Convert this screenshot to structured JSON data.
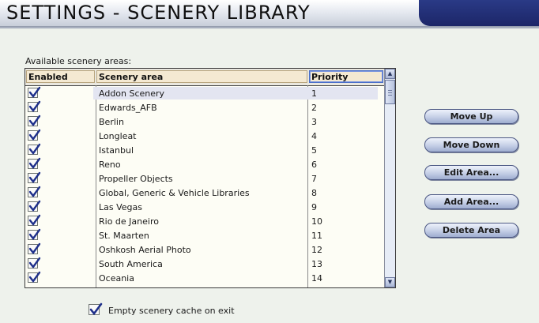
{
  "header": {
    "title": "SETTINGS - SCENERY LIBRARY"
  },
  "list_label": "Available scenery areas:",
  "columns": {
    "enabled": "Enabled",
    "area": "Scenery area",
    "priority": "Priority"
  },
  "rows": [
    {
      "enabled": true,
      "name": "Addon Scenery",
      "priority": "1"
    },
    {
      "enabled": true,
      "name": "Edwards_AFB",
      "priority": "2"
    },
    {
      "enabled": true,
      "name": "Berlin",
      "priority": "3"
    },
    {
      "enabled": true,
      "name": "Longleat",
      "priority": "4"
    },
    {
      "enabled": true,
      "name": "Istanbul",
      "priority": "5"
    },
    {
      "enabled": true,
      "name": "Reno",
      "priority": "6"
    },
    {
      "enabled": true,
      "name": "Propeller Objects",
      "priority": "7"
    },
    {
      "enabled": true,
      "name": "Global, Generic & Vehicle Libraries",
      "priority": "8"
    },
    {
      "enabled": true,
      "name": "Las Vegas",
      "priority": "9"
    },
    {
      "enabled": true,
      "name": "Rio de Janeiro",
      "priority": "10"
    },
    {
      "enabled": true,
      "name": "St. Maarten",
      "priority": "11"
    },
    {
      "enabled": true,
      "name": "Oshkosh Aerial Photo",
      "priority": "12"
    },
    {
      "enabled": true,
      "name": "South America",
      "priority": "13"
    },
    {
      "enabled": true,
      "name": "Oceania",
      "priority": "14"
    }
  ],
  "buttons": {
    "move_up": "Move Up",
    "move_down": "Move Down",
    "edit_area": "Edit Area...",
    "add_area": "Add Area...",
    "delete_area": "Delete Area"
  },
  "cache": {
    "label": "Empty scenery cache on exit",
    "checked": true
  },
  "icons": {
    "check": "checkmark-icon",
    "scroll_up": "arrow-up-icon",
    "scroll_down": "arrow-down-icon"
  },
  "colors": {
    "header_accent": "#1c2668",
    "check_color": "#1e2f8a"
  }
}
